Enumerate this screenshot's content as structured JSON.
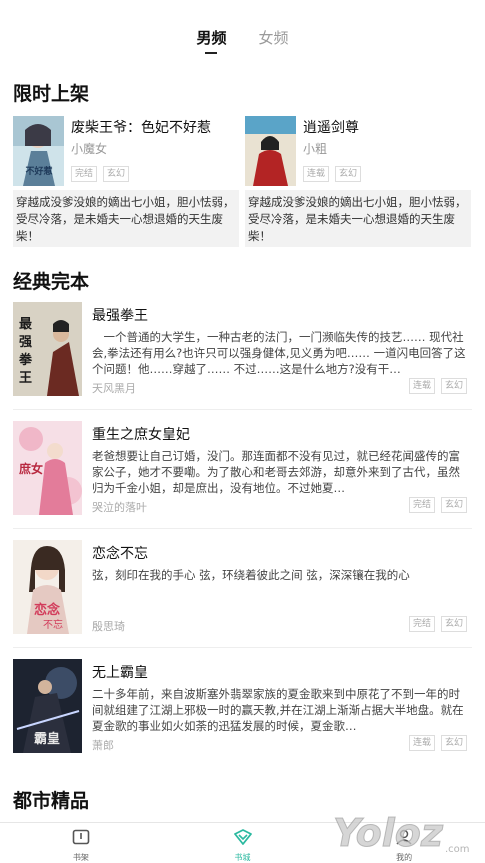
{
  "tabs": [
    {
      "label": "男频",
      "active": true
    },
    {
      "label": "女频",
      "active": false
    }
  ],
  "sections": {
    "limited": "限时上架",
    "classic": "经典完本",
    "urban": "都市精品"
  },
  "featured": [
    {
      "title": "废柴王爷：色妃不好惹",
      "author": "小魔女",
      "tags": [
        "完结",
        "玄幻"
      ],
      "desc": "穿越成没爹没娘的嫡出七小姐，胆小怯弱，受尽冷落，是未婚夫一心想退婚的天生废柴！"
    },
    {
      "title": "逍遥剑尊",
      "author": "小粗",
      "tags": [
        "连载",
        "玄幻"
      ],
      "desc": "穿越成没爹没娘的嫡出七小姐，胆小怯弱，受尽冷落，是未婚夫一心想退婚的天生废柴！"
    }
  ],
  "books": [
    {
      "title": "最强拳王",
      "desc": "　一个普通的大学生，一种古老的法门，一门濒临失传的技艺…… 现代社会,拳法还有用么?也许只可以强身健体,见义勇为吧…… 一道闪电回答了这个问题！他……穿越了…… 不过……这是什么地方?没有干…",
      "author": "天风黑月",
      "tags": [
        "连载",
        "玄幻"
      ]
    },
    {
      "title": "重生之庶女皇妃",
      "desc": "老爸想要让自己订婚，没门。那连面都不没有见过，就已经花闻盛传的富家公子，她才不要嘞。为了散心和老哥去郊游，却意外来到了古代，虽然归为千金小姐，却是庶出，没有地位。不过她夏…",
      "author": "哭泣的落叶",
      "tags": [
        "完结",
        "玄幻"
      ]
    },
    {
      "title": "恋念不忘",
      "desc": "弦，刻印在我的手心 弦，环绕着彼此之间 弦，深深镶在我的心",
      "author": "殷思琦",
      "tags": [
        "完结",
        "玄幻"
      ]
    },
    {
      "title": "无上霸皇",
      "desc": "二十多年前，来自波斯塞外翡翠家族的夏金歌来到中原花了不到一年的时间就组建了江湖上邪极一时的赢天教,并在江湖上渐渐占据大半地盘。就在夏金歌的事业如火如荼的迅猛发展的时候，夏金歌…",
      "author": "萧郎",
      "tags": [
        "连载",
        "玄幻"
      ]
    }
  ],
  "bottom_nav": [
    {
      "label": "书架",
      "icon": "bookshelf-icon"
    },
    {
      "label": "书城",
      "icon": "bookstore-icon",
      "active": true
    },
    {
      "label": "我的",
      "icon": "profile-icon"
    }
  ],
  "watermark": {
    "text": "Yoloz",
    "suffix": ".com"
  },
  "colors": {
    "accent": "#2bb9a0",
    "text": "#222222",
    "muted": "#999999",
    "desc_bg": "#f2f2f2"
  }
}
